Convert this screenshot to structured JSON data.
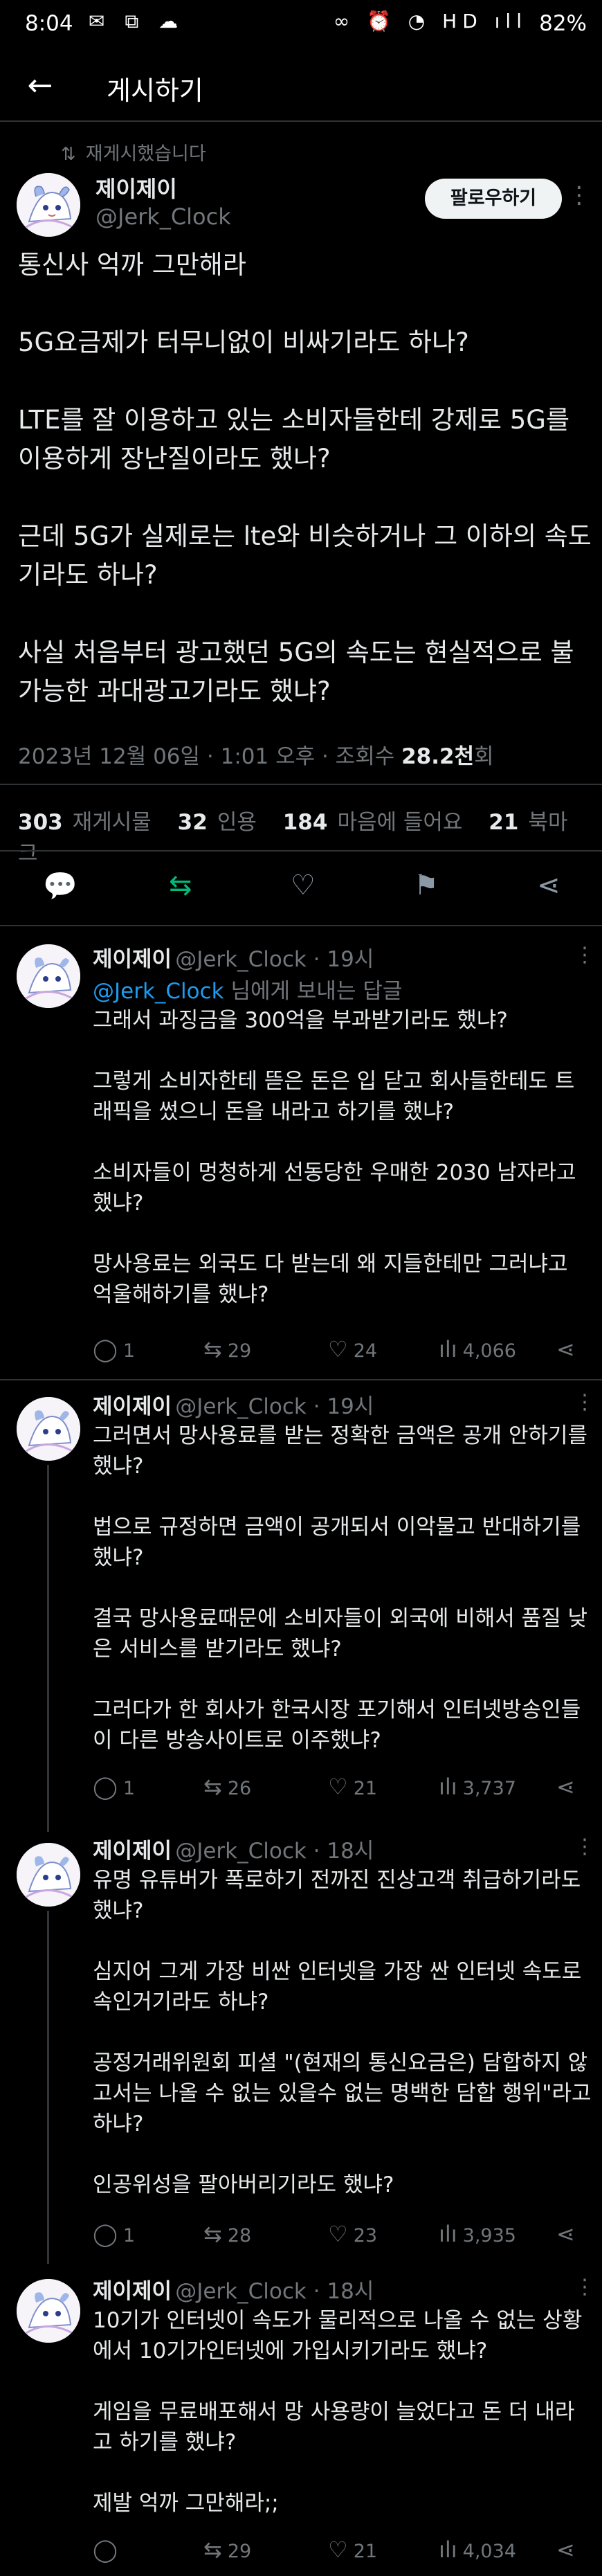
{
  "status_bar": {
    "time": "8:04",
    "left_icons": "✉ ⧉ ☁",
    "right_icons": "∞ ⏰ ◔ HD ıll",
    "battery": "82%"
  },
  "app_bar": {
    "title": "게시하기"
  },
  "main_post": {
    "repost_note": "재게시했습니다",
    "name": "제이제이",
    "handle": "@Jerk_Clock",
    "follow_label": "팔로우하기",
    "body": "통신사 억까 그만해라\n\n5G요금제가 터무니없이 비싸기라도 하나?\n\nLTE를 잘 이용하고 있는 소비자들한테 강제로 5G를 이용하게 장난질이라도 했나?\n\n근데 5G가 실제로는 lte와 비슷하거나 그 이하의 속도기라도 하나?\n\n사실 처음부터 광고했던 5G의 속도는 현실적으로 불가능한 과대광고기라도 했냐?",
    "meta_prefix": "2023년 12월 06일 · 1:01 오후 · 조회수 ",
    "views": "28.2천",
    "meta_suffix": "회",
    "stats": [
      {
        "count": "303",
        "label": "재게시물"
      },
      {
        "count": "32",
        "label": "인용"
      },
      {
        "count": "184",
        "label": "마음에 들어요"
      },
      {
        "count": "21",
        "label": "북마크"
      }
    ]
  },
  "replies": [
    {
      "name": "제이제이",
      "handle": "@Jerk_Clock · 19시",
      "reply_to_mention": "@Jerk_Clock",
      "reply_to_suffix": " 님에게 보내는 답글",
      "body": "그래서 과징금을 300억을 부과받기라도 했냐?\n\n그렇게 소비자한테 뜯은 돈은 입 닫고 회사들한테도 트래픽을 썼으니 돈을 내라고 하기를 했냐?\n\n소비자들이 멍청하게 선동당한 우매한 2030 남자라고 했냐?\n\n망사용료는 외국도 다 받는데 왜 지들한테만 그러냐고 억울해하기를 했냐?",
      "replies": "1",
      "reposts": "29",
      "likes": "24",
      "views": "4,066"
    },
    {
      "name": "제이제이",
      "handle": "@Jerk_Clock · 19시",
      "body": "그러면서 망사용료를 받는 정확한 금액은 공개 안하기를 했냐?\n\n법으로 규정하면 금액이 공개되서 이악물고 반대하기를 했냐?\n\n결국 망사용료때문에 소비자들이 외국에 비해서 품질 낮은 서비스를 받기라도 했냐?\n\n그러다가 한 회사가 한국시장 포기해서 인터넷방송인들이 다른 방송사이트로 이주했냐?",
      "replies": "1",
      "reposts": "26",
      "likes": "21",
      "views": "3,737"
    },
    {
      "name": "제이제이",
      "handle": "@Jerk_Clock · 18시",
      "body": "유명 유튜버가 폭로하기 전까진 진상고객 취급하기라도 했냐?\n\n심지어 그게 가장 비싼 인터넷을 가장 싼 인터넷 속도로 속인거기라도 하냐?\n\n공정거래위원회 피셜 \"(현재의 통신요금은) 담합하지 않고서는 나올 수 없는 있을수 없는 명백한 담합 행위\"라고 하냐?\n\n인공위성을 팔아버리기라도 했냐?",
      "replies": "1",
      "reposts": "28",
      "likes": "23",
      "views": "3,935"
    },
    {
      "name": "제이제이",
      "handle": "@Jerk_Clock · 18시",
      "body": "10기가 인터넷이 속도가 물리적으로 나올 수 없는 상황에서 10기가인터넷에 가입시키기라도 했냐?\n\n게임을 무료배포해서 망 사용량이 늘었다고 돈 더 내라고 하기를 했냐?\n\n제발 억까 그만해라;;",
      "replies": "",
      "reposts": "29",
      "likes": "21",
      "views": "4,034"
    }
  ],
  "colors": {
    "background": "#000000",
    "text": "#e7e9ea",
    "muted": "#71767b",
    "link": "#1d9bf0",
    "repost_active": "#00ba7c"
  }
}
